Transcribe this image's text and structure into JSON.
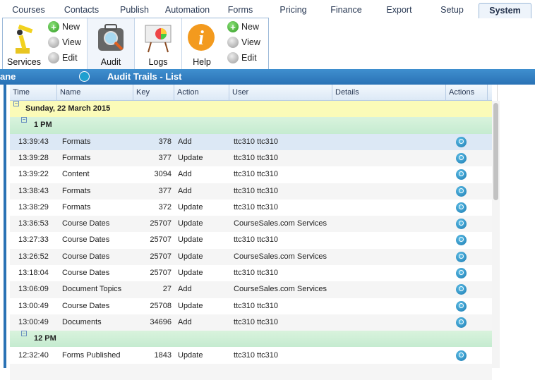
{
  "tabs": [
    "Courses",
    "Contacts",
    "Publish",
    "Automation",
    "Forms",
    "Pricing",
    "Finance",
    "Export",
    "Setup",
    "System"
  ],
  "ribbon": {
    "services": "Services",
    "new1": "New",
    "view1": "View",
    "edit1": "Edit",
    "audit": "Audit",
    "logs": "Logs",
    "help": "Help",
    "new2": "New",
    "view2": "View",
    "edit2": "Edit"
  },
  "bar": {
    "left": "ane",
    "title": "Audit Trails - List"
  },
  "columns": [
    "Time",
    "Name",
    "Key",
    "Action",
    "User",
    "Details",
    "Actions"
  ],
  "day": "Sunday, 22 March 2015",
  "groups": [
    {
      "label": "1 PM",
      "rows": [
        [
          "13:39:43",
          "Formats",
          "378",
          "Add",
          "ttc310 ttc310"
        ],
        [
          "13:39:28",
          "Formats",
          "377",
          "Update",
          "ttc310 ttc310"
        ],
        [
          "13:39:22",
          "Content",
          "3094",
          "Add",
          "ttc310 ttc310"
        ],
        [
          "13:38:43",
          "Formats",
          "377",
          "Add",
          "ttc310 ttc310"
        ],
        [
          "13:38:29",
          "Formats",
          "372",
          "Update",
          "ttc310 ttc310"
        ],
        [
          "13:36:53",
          "Course Dates",
          "25707",
          "Update",
          "CourseSales.com Services"
        ],
        [
          "13:27:33",
          "Course Dates",
          "25707",
          "Update",
          "ttc310 ttc310"
        ],
        [
          "13:26:52",
          "Course Dates",
          "25707",
          "Update",
          "CourseSales.com Services"
        ],
        [
          "13:18:04",
          "Course Dates",
          "25707",
          "Update",
          "ttc310 ttc310"
        ],
        [
          "13:06:09",
          "Document Topics",
          "27",
          "Add",
          "CourseSales.com Services"
        ],
        [
          "13:00:49",
          "Course Dates",
          "25708",
          "Update",
          "ttc310 ttc310"
        ],
        [
          "13:00:49",
          "Documents",
          "34696",
          "Add",
          "ttc310 ttc310"
        ]
      ]
    },
    {
      "label": "12 PM",
      "rows": [
        [
          "12:32:40",
          "Forms Published",
          "1843",
          "Update",
          "ttc310 ttc310"
        ]
      ]
    }
  ]
}
